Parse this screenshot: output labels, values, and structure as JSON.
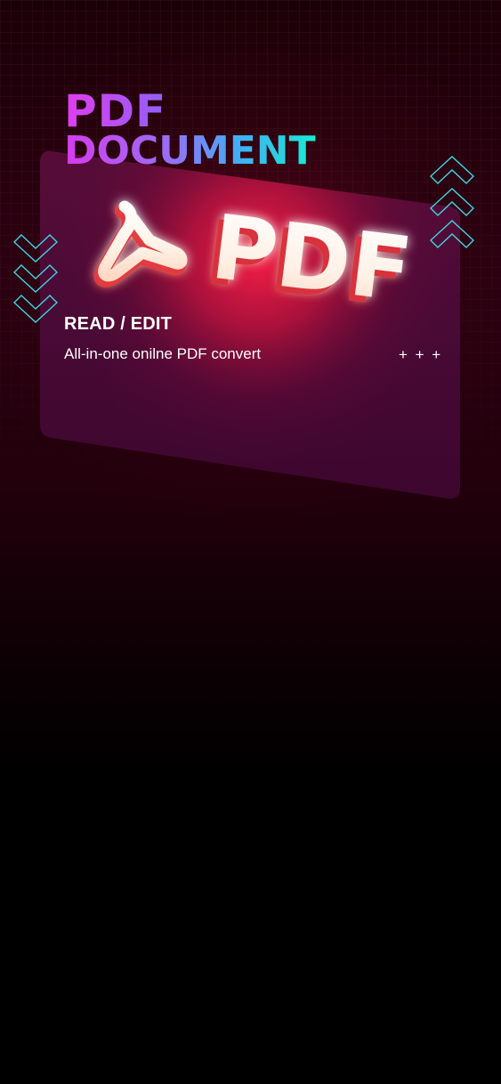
{
  "hero": {
    "title_line1": "PDF",
    "title_line2": "DOCUMENT",
    "logo_text": "PDF",
    "logo_icon": "acrobat-logo-icon",
    "subtitle": "READ / EDIT",
    "tagline": "All-in-one onilne PDF convert",
    "plus_marks": "+ + +"
  },
  "decor": {
    "left_chevrons": "chevron-down-icon",
    "right_chevrons": "chevron-up-icon",
    "chevron_color": "#3fd3e0",
    "card_color": "#4a0a3c",
    "glow_color": "#ff1a3c"
  }
}
